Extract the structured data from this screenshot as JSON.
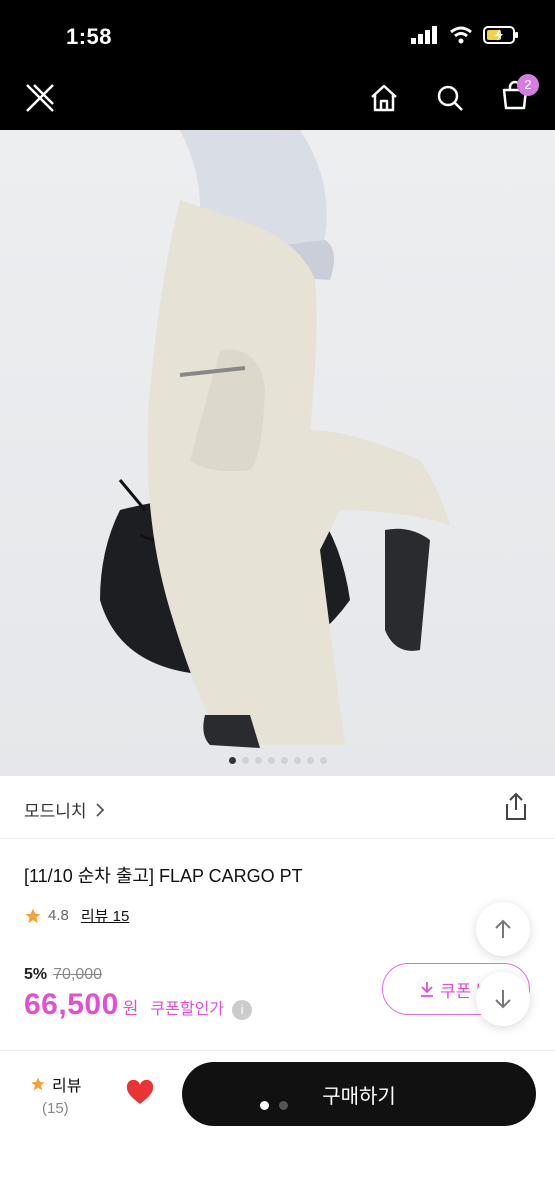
{
  "status": {
    "time": "1:58"
  },
  "nav": {
    "cart_count": "2"
  },
  "hero": {
    "slide_count": 8,
    "active_index": 0
  },
  "product": {
    "brand": "모드니치",
    "title": "[11/10 순차 출고] FLAP CARGO PT",
    "rating": "4.8",
    "review_label": "리뷰 15",
    "discount": "5%",
    "original_price": "70,000",
    "price": "66,500",
    "currency": "원",
    "coupon_label": "쿠폰할인가"
  },
  "coupon_button": {
    "label": "쿠폰 받"
  },
  "bottom": {
    "review_label": "리뷰",
    "review_count": "(15)",
    "buy_label": "구매하기"
  },
  "colors": {
    "accent": "#e24fd0",
    "badge": "#d57be3",
    "topbar": "#000000"
  }
}
